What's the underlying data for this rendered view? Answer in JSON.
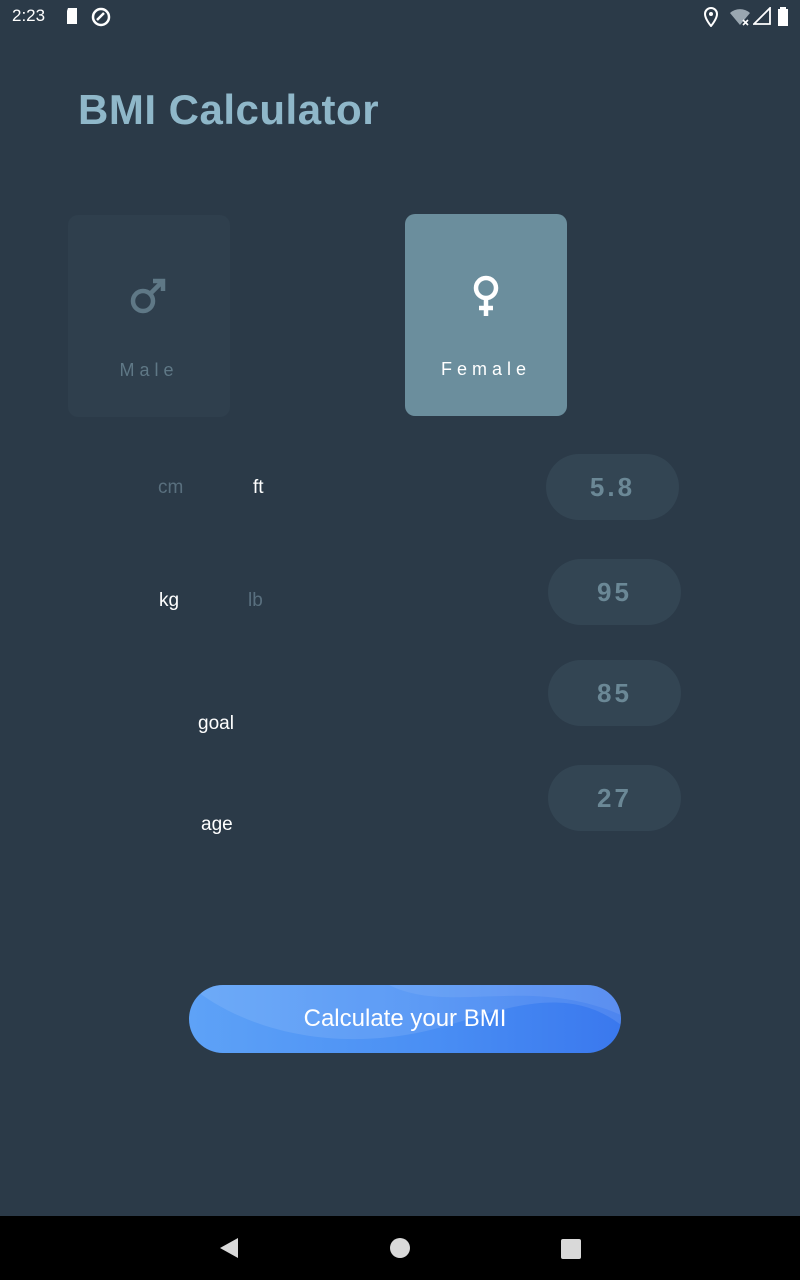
{
  "status_bar": {
    "time": "2:23",
    "icons": [
      "sd-card-icon",
      "sync-icon",
      "location-icon",
      "wifi-icon",
      "signal-icon",
      "battery-icon"
    ]
  },
  "app": {
    "title": "BMI Calculator"
  },
  "gender": {
    "male_label": "Male",
    "female_label": "Female",
    "selected": "female"
  },
  "height": {
    "unit_cm": "cm",
    "unit_ft": "ft",
    "selected_unit": "ft",
    "value": "5.8"
  },
  "weight": {
    "unit_kg": "kg",
    "unit_lb": "lb",
    "selected_unit": "kg",
    "value": "95"
  },
  "goal": {
    "label": "goal",
    "value": "85"
  },
  "age": {
    "label": "age",
    "value": "27"
  },
  "action": {
    "calculate_label": "Calculate your BMI"
  },
  "colors": {
    "background": "#2b3a48",
    "title": "#8fb7c9",
    "selected_card": "#6b8e9d",
    "unselected_card": "#2f3f4d",
    "button": "#4a8ff4"
  },
  "nav": {
    "icons": [
      "back-icon",
      "home-icon",
      "recents-icon"
    ]
  }
}
